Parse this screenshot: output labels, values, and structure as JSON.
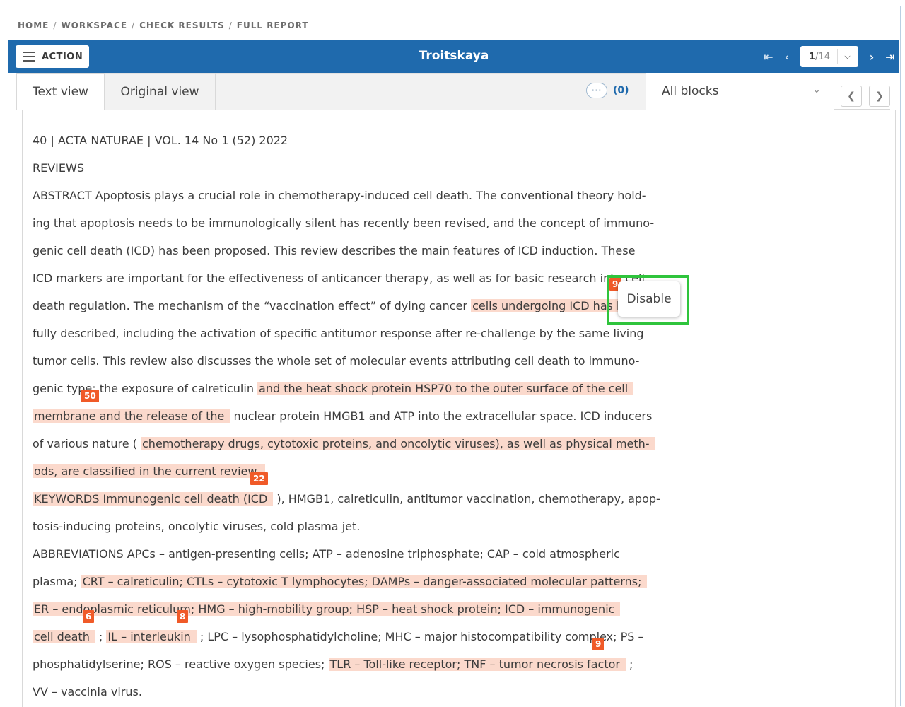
{
  "breadcrumb": [
    "HOME",
    "WORKSPACE",
    "CHECK RESULTS",
    "FULL REPORT"
  ],
  "breadcrumb_sep": "/",
  "topbar": {
    "action_label": "ACTION",
    "title": "Troitskaya",
    "page_current": "1",
    "page_total": "/14",
    "first_icon": "⇤",
    "prev_icon": "‹",
    "next_icon": "›",
    "last_icon": "⇥"
  },
  "tabs": {
    "text_view": "Text view",
    "original_view": "Original view",
    "comments_count": "(0)",
    "blocks_select": "All blocks"
  },
  "popup": {
    "label": "Disable"
  },
  "document": {
    "lines": [
      [
        {
          "t": "40 | ACTA NATURAE | VOL. 14 No 1 (52) 2022"
        }
      ],
      [
        {
          "t": "REVIEWS"
        }
      ],
      [
        {
          "t": "ABSTRACT Apoptosis plays a crucial role in chemotherapy-induced cell death. The conventional theory hold-"
        }
      ],
      [
        {
          "t": "ing that apoptosis needs to be immunologically silent has recently been revised, and the concept of immuno-"
        }
      ],
      [
        {
          "t": "genic cell death (ICD) has been proposed. This review describes the main features of ICD induction. These"
        }
      ],
      [
        {
          "t": "ICD markers are important for the effectiveness of anticancer therapy, as well as for basic research into cell"
        }
      ],
      [
        {
          "t": "death regulation. The mechanism of the “vaccination effect” of dying cancer  "
        },
        {
          "t": "cells undergoing ICD has been",
          "h": true
        }
      ],
      [
        {
          "t": "fully described, including the activation of specific antitumor response after re-challenge by the same living"
        }
      ],
      [
        {
          "t": "tumor cells. This review also discusses the whole set of molecular events attributing cell death to immuno-"
        }
      ],
      [
        {
          "t": "genic type: the exposure of calreticulin  "
        },
        {
          "t": "and the heat shock protein HSP70 to the outer surface of the cell",
          "h": true
        }
      ],
      [
        {
          "t": "membrane and the release of the",
          "h": true
        },
        {
          "t": "  nuclear protein HMGB1 and ATP into the extracellular space. ICD inducers"
        }
      ],
      [
        {
          "t": "of various nature ( "
        },
        {
          "t": "chemotherapy drugs, cytotoxic proteins, and oncolytic viruses), as well as physical meth-",
          "h": true
        }
      ],
      [
        {
          "t": "ods, are classified in the current review.",
          "h": true
        }
      ],
      [
        {
          "t": "KEYWORDS Immunogenic cell death (ICD",
          "h": true
        },
        {
          "t": "  ), HMGB1, calreticulin, antitumor vaccination, chemotherapy, apop-"
        }
      ],
      [
        {
          "t": "tosis-inducing proteins, oncolytic viruses, cold plasma jet."
        }
      ],
      [
        {
          "t": "ABBREVIATIONS APCs – antigen-presenting cells; ATP – adenosine triphosphate; CAP – cold atmospheric"
        }
      ],
      [
        {
          "t": "plasma;  "
        },
        {
          "t": "CRT – calreticulin; CTLs – cytotoxic T lymphocytes; DAMPs – danger-associated molecular patterns;",
          "h": true
        }
      ],
      [
        {
          "t": "ER – endoplasmic reticulum; HMG – high-mobility group; HSP – heat shock protein; ICD – immunogenic",
          "h": true
        }
      ],
      [
        {
          "t": "cell death",
          "h": true
        },
        {
          "t": " ; "
        },
        {
          "t": "IL – interleukin",
          "h": true
        },
        {
          "t": " ; LPC – lysophosphatidylcholine; MHC – major histocompatibility complex; PS –"
        }
      ],
      [
        {
          "t": "phosphatidylserine; ROS – reactive oxygen species;  "
        },
        {
          "t": "TLR – Toll-like receptor; TNF – tumor necrosis factor",
          "h": true
        },
        {
          "t": " ;"
        }
      ],
      [
        {
          "t": "VV – vaccinia virus."
        }
      ]
    ],
    "badges": [
      "9",
      "50",
      "22",
      "6",
      "8",
      "9"
    ]
  },
  "colors": {
    "topbar": "#1f6aad",
    "highlight": "#fbd9cc",
    "badge": "#f05a28",
    "popup_outline": "#2fc43c"
  },
  "icons": {
    "menu": "hamburger-icon",
    "comments": "comment-bubble-icon",
    "dropdown": "chevron-down-icon"
  }
}
